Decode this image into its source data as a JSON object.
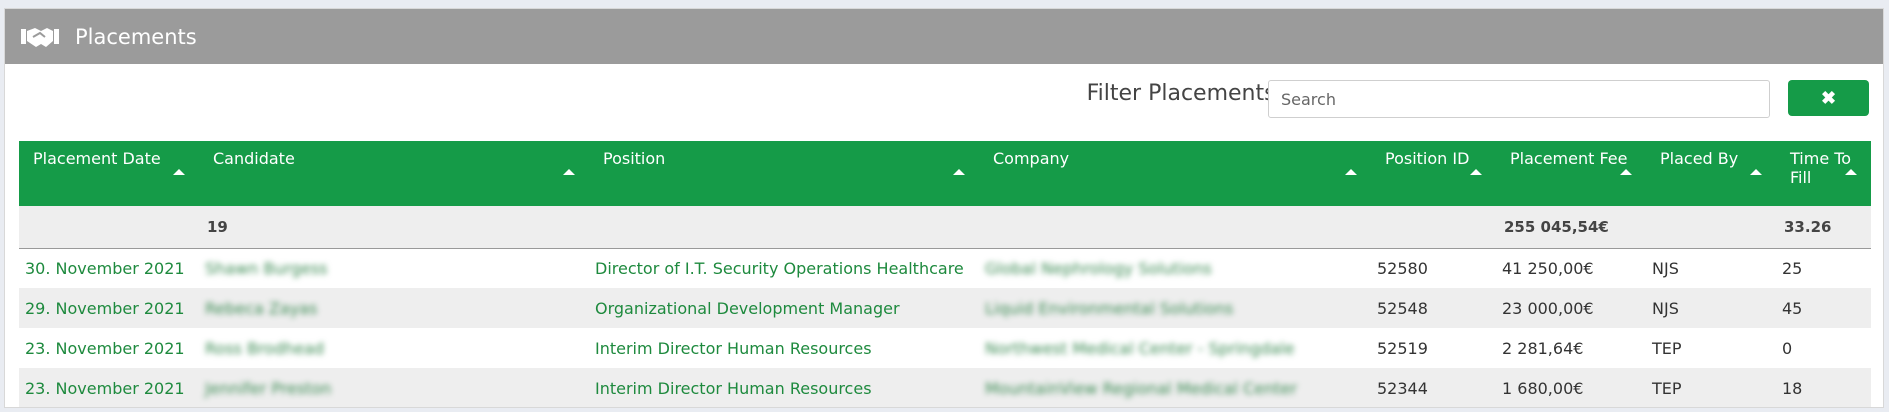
{
  "header": {
    "title": "Placements",
    "icon": "handshake-icon"
  },
  "filter": {
    "label": "Filter Placements:",
    "placeholder": "Search",
    "value": "",
    "clear_label": "✖"
  },
  "table": {
    "columns": [
      "Placement Date",
      "Candidate",
      "Position",
      "Company",
      "Position ID",
      "Placement Fee",
      "Placed By",
      "Time To Fill"
    ],
    "summary": {
      "count": "19",
      "fee_total": "255 045,54€",
      "avg_time": "33.26"
    },
    "rows": [
      {
        "date": "30. November 2021",
        "candidate": "Shawn Burgess",
        "position": "Director of I.T. Security Operations Healthcare",
        "company": "Global Nephrology Solutions",
        "position_id": "52580",
        "fee": "41 250,00€",
        "placed_by": "NJS",
        "time_to_fill": "25"
      },
      {
        "date": "29. November 2021",
        "candidate": "Rebeca Zayas",
        "position": "Organizational Development Manager",
        "company": "Liquid Environmental Solutions",
        "position_id": "52548",
        "fee": "23 000,00€",
        "placed_by": "NJS",
        "time_to_fill": "45"
      },
      {
        "date": "23. November 2021",
        "candidate": "Ross Brodhead",
        "position": "Interim Director Human Resources",
        "company": "Northwest Medical Center - Springdale",
        "position_id": "52519",
        "fee": "2 281,64€",
        "placed_by": "TEP",
        "time_to_fill": "0"
      },
      {
        "date": "23. November 2021",
        "candidate": "Jennifer Preston",
        "position": "Interim Director Human Resources",
        "company": "MountainView Regional Medical Center",
        "position_id": "52344",
        "fee": "1 680,00€",
        "placed_by": "TEP",
        "time_to_fill": "18"
      }
    ]
  },
  "colors": {
    "header_bg": "#9b9b9b",
    "accent": "#159b48",
    "link": "#1e8a3e"
  }
}
